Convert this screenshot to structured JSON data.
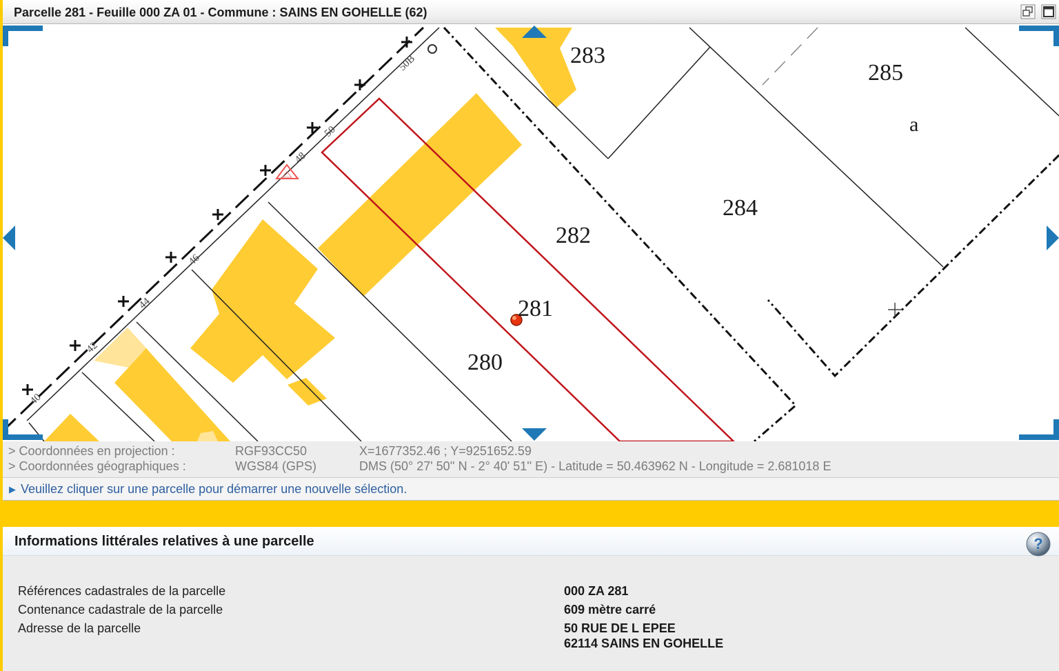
{
  "window": {
    "title": "Parcelle 281 - Feuille 000 ZA 01 - Commune : SAINS EN GOHELLE (62)",
    "restore_icon": "restore-window-icon",
    "maximize_icon": "maximize-window-icon"
  },
  "map": {
    "parcel_numbers": [
      "283",
      "285",
      "284",
      "282",
      "281",
      "280"
    ],
    "subdivision_letter": "a",
    "street_numbers": [
      "50B",
      "50",
      "48",
      "46",
      "44",
      "42",
      "40"
    ],
    "selected_parcel": "281",
    "colors": {
      "building": "#ffcc33",
      "building_light": "#ffe49a",
      "selection": "#c0151b",
      "nav": "#1f79b6"
    }
  },
  "coordinates": {
    "projection_label": "> Coordonnées en projection :",
    "projection_system": "RGF93CC50",
    "projection_value": "X=1677352.46 ; Y=9251652.59",
    "geographic_label": "> Coordonnées géographiques :",
    "geographic_system": "WGS84 (GPS)",
    "geographic_value": "DMS (50° 27' 50'' N - 2° 40' 51'' E) - Latitude = 50.463962 N - Longitude = 2.681018 E"
  },
  "hint": {
    "text": "Veuillez cliquer sur une parcelle pour démarrer une nouvelle sélection."
  },
  "info": {
    "title": "Informations littérales relatives à une parcelle",
    "rows": [
      {
        "label": "Références cadastrales de la parcelle",
        "value": "000 ZA 281"
      },
      {
        "label": "Contenance cadastrale de la parcelle",
        "value": "609 mètre carré"
      },
      {
        "label": "Adresse de la parcelle",
        "value": "50 RUE DE L EPEE",
        "value2": "62114 SAINS EN GOHELLE"
      }
    ]
  }
}
